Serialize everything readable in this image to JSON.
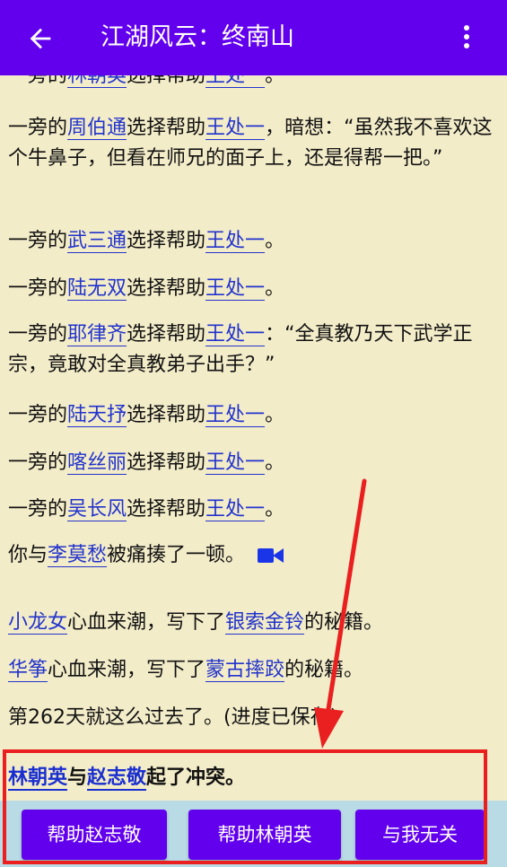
{
  "appbar": {
    "title": "江湖风云：终南山",
    "back_icon": "arrow-left-icon",
    "menu_icon": "more-vert-icon"
  },
  "log": [
    {
      "pre": "一旁的",
      "a": "林朝英",
      "mid": "选择帮助",
      "b": "王处一",
      "post": "。"
    },
    {
      "pre": "一旁的",
      "a": "周伯通",
      "mid": "选择帮助",
      "b": "王处一",
      "post": "，暗想：“虽然我不喜欢这个牛鼻子，但看在师兄的面子上，还是得帮一把。”"
    },
    {
      "pre": "一旁的",
      "a": "武三通",
      "mid": "选择帮助",
      "b": "王处一",
      "post": "。"
    },
    {
      "pre": "一旁的",
      "a": "陆无双",
      "mid": "选择帮助",
      "b": "王处一",
      "post": "。"
    },
    {
      "pre": "一旁的",
      "a": "耶律齐",
      "mid": "选择帮助",
      "b": "王处一",
      "post": "：“全真教乃天下武学正宗，竟敢对全真教弟子出手？”"
    },
    {
      "pre": "一旁的",
      "a": "陆天抒",
      "mid": "选择帮助",
      "b": "王处一",
      "post": "。"
    },
    {
      "pre": "一旁的",
      "a": "喀丝丽",
      "mid": "选择帮助",
      "b": "王处一",
      "post": "。"
    },
    {
      "pre": "一旁的",
      "a": "吴长风",
      "mid": "选择帮助",
      "b": "王处一",
      "post": "。"
    },
    {
      "pre": "你与",
      "a": "李莫愁",
      "mid": "被痛揍了一顿。",
      "b": "",
      "post": ""
    },
    {
      "pre": "",
      "a": "小龙女",
      "mid": "心血来潮，写下了",
      "b": "银索金铃",
      "post": "的秘籍。"
    },
    {
      "pre": "",
      "a": "华筝",
      "mid": "心血来潮，写下了",
      "b": "蒙古摔跤",
      "post": "的秘籍。"
    },
    {
      "pre": "第262天就这么过去了。(进度已保存)",
      "a": "",
      "mid": "",
      "b": "",
      "post": ""
    }
  ],
  "beating_video_icon": "video-camera-icon",
  "conflict": {
    "a": "林朝英",
    "mid1": "与",
    "b": "赵志敬",
    "mid2": "起了冲突。"
  },
  "buttons": [
    "帮助赵志敬",
    "帮助林朝英",
    "与我无关"
  ],
  "colors": {
    "appbar": "#6200ee",
    "background": "#f3ecc9",
    "link": "#2233cc",
    "button_bar": "#b8dbe6",
    "annotation": "#ea1f1f"
  }
}
